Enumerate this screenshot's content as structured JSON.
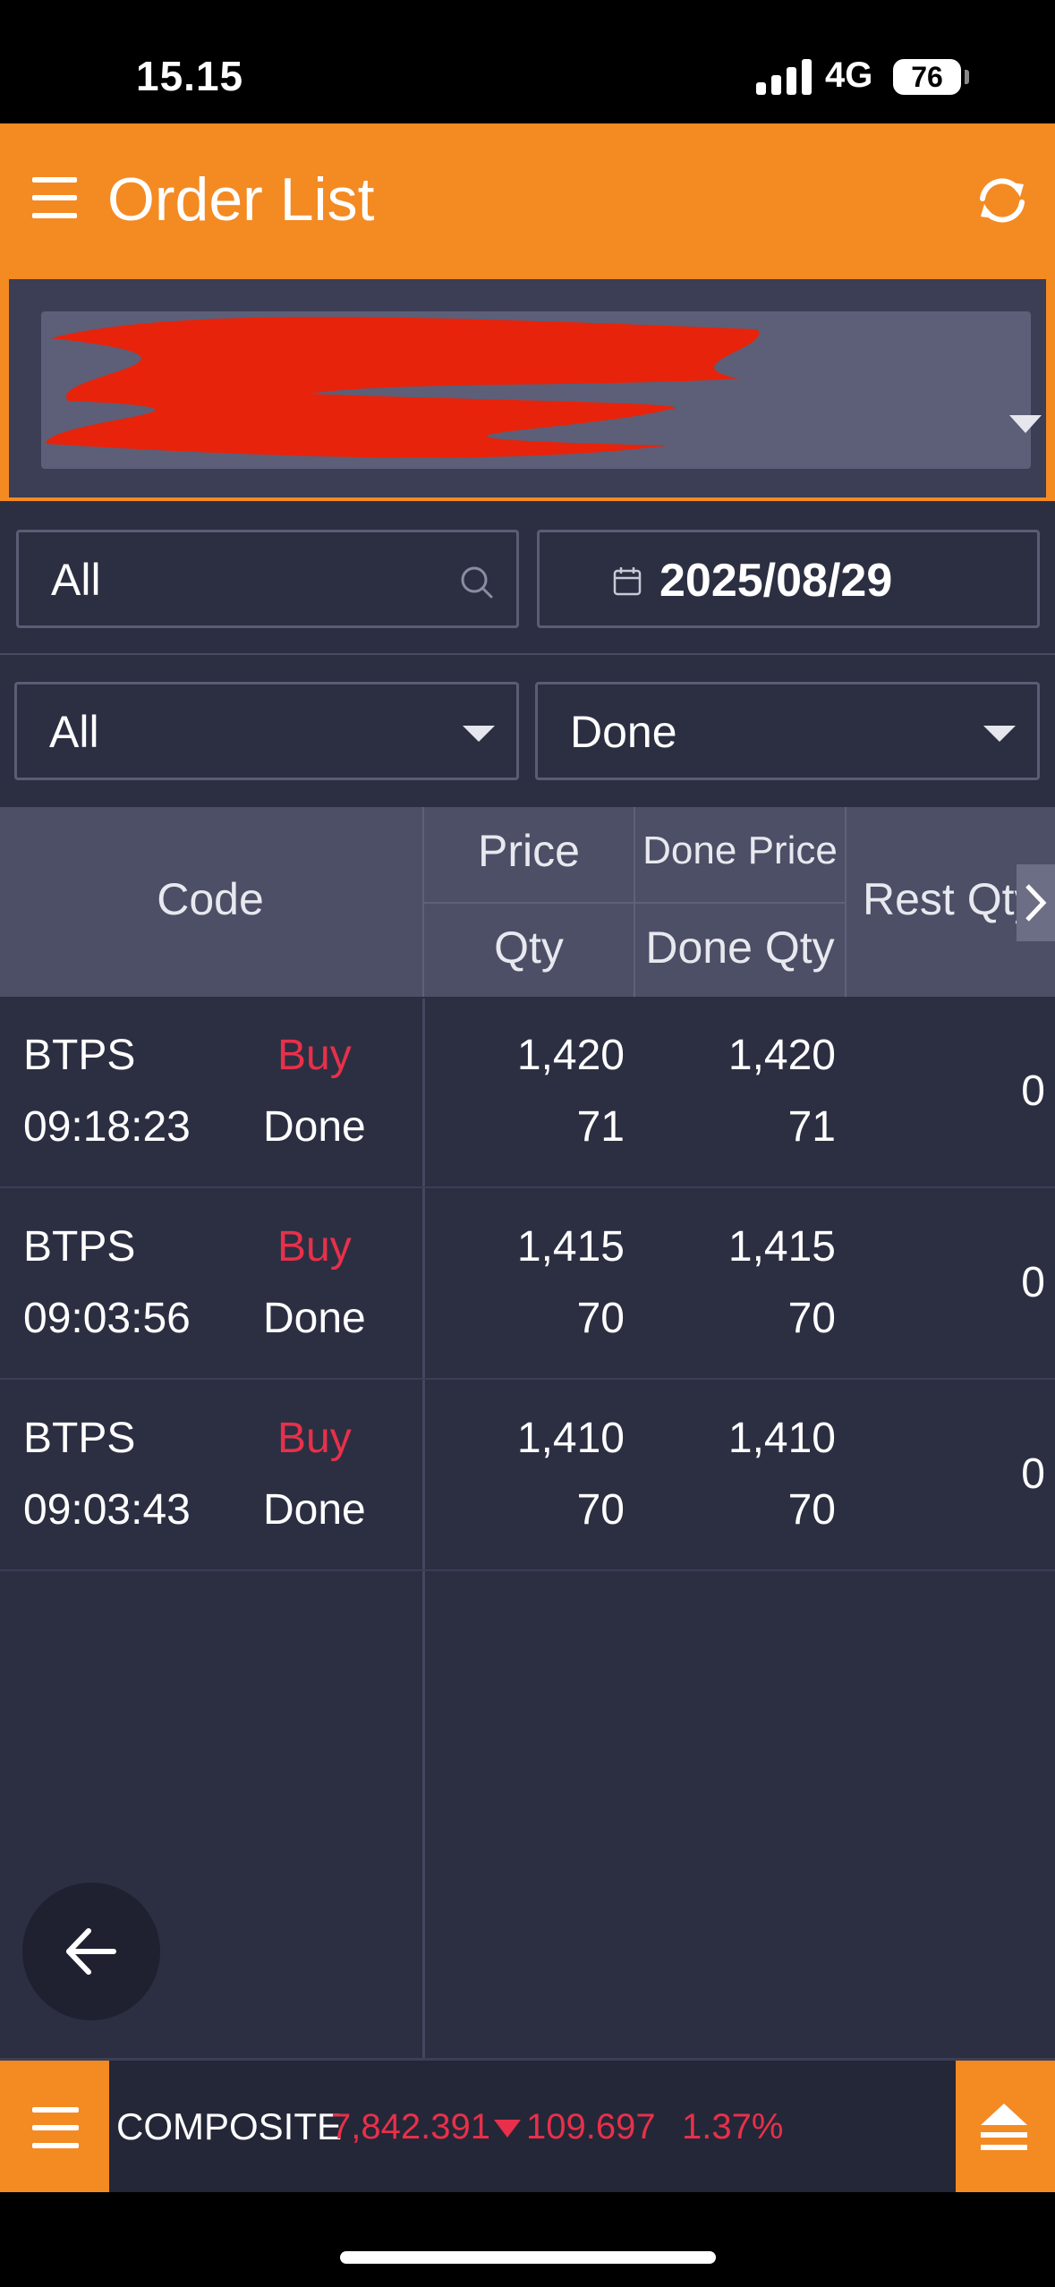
{
  "status_bar": {
    "time": "15.15",
    "network": "4G",
    "battery": "76"
  },
  "header": {
    "title": "Order List"
  },
  "filters": {
    "search_value": "All",
    "date": "2025/08/29",
    "side_value": "All",
    "status_value": "Done"
  },
  "table": {
    "headers": {
      "code": "Code",
      "price": "Price",
      "qty": "Qty",
      "done_price": "Done Price",
      "done_qty": "Done Qty",
      "rest_qty": "Rest Qty"
    },
    "rows": [
      {
        "code": "BTPS",
        "side": "Buy",
        "time": "09:18:23",
        "status": "Done",
        "price": "1,420",
        "qty": "71",
        "done_price": "1,420",
        "done_qty": "71",
        "rest_qty": "0"
      },
      {
        "code": "BTPS",
        "side": "Buy",
        "time": "09:03:56",
        "status": "Done",
        "price": "1,415",
        "qty": "70",
        "done_price": "1,415",
        "done_qty": "70",
        "rest_qty": "0"
      },
      {
        "code": "BTPS",
        "side": "Buy",
        "time": "09:03:43",
        "status": "Done",
        "price": "1,410",
        "qty": "70",
        "done_price": "1,410",
        "done_qty": "70",
        "rest_qty": "0"
      }
    ]
  },
  "ticker": {
    "label": "COMPOSITE",
    "value": "7,842.391",
    "change": "109.697",
    "percent": "1.37%"
  },
  "colors": {
    "accent": "#f48a22",
    "background": "#2c2f42",
    "sell_buy_red": "#e8304a"
  },
  "icons": [
    "hamburger-menu-icon",
    "refresh-icon",
    "search-icon",
    "calendar-icon",
    "chevron-down-icon",
    "chevron-right-icon",
    "back-arrow-icon",
    "triangle-down-icon",
    "collapse-up-icon"
  ]
}
